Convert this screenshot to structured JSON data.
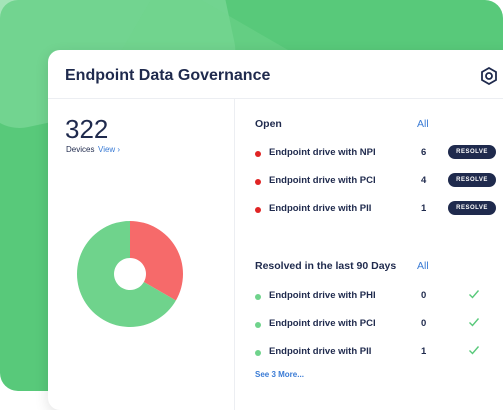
{
  "card": {
    "title": "Endpoint Data Governance",
    "settings_icon": "hexagon-settings-icon"
  },
  "devices": {
    "count": "322",
    "label": "Devices",
    "view_link": "View ›"
  },
  "chart_data": {
    "type": "pie",
    "categories": [
      "Open",
      "Resolved"
    ],
    "values": [
      11,
      22
    ],
    "colors": [
      "#f66a6a",
      "#6fd38c"
    ]
  },
  "open_section": {
    "title": "Open",
    "all_link": "All",
    "items": [
      {
        "label": "Endpoint drive with NPI",
        "count": "6",
        "action": "RESOLVE"
      },
      {
        "label": "Endpoint drive with PCI",
        "count": "4",
        "action": "RESOLVE"
      },
      {
        "label": "Endpoint drive with PII",
        "count": "1",
        "action": "RESOLVE"
      }
    ]
  },
  "resolved_section": {
    "title": "Resolved in the last 90 Days",
    "all_link": "All",
    "items": [
      {
        "label": "Endpoint drive with PHI",
        "count": "0"
      },
      {
        "label": "Endpoint drive with PCI",
        "count": "0"
      },
      {
        "label": "Endpoint drive with PII",
        "count": "1"
      }
    ],
    "see_more": "See 3 More..."
  },
  "colors": {
    "navy": "#1f2a4d",
    "red_dot": "#e02424",
    "green_dot": "#6fd38c",
    "link": "#3a7bd5",
    "check": "#58c97a"
  }
}
